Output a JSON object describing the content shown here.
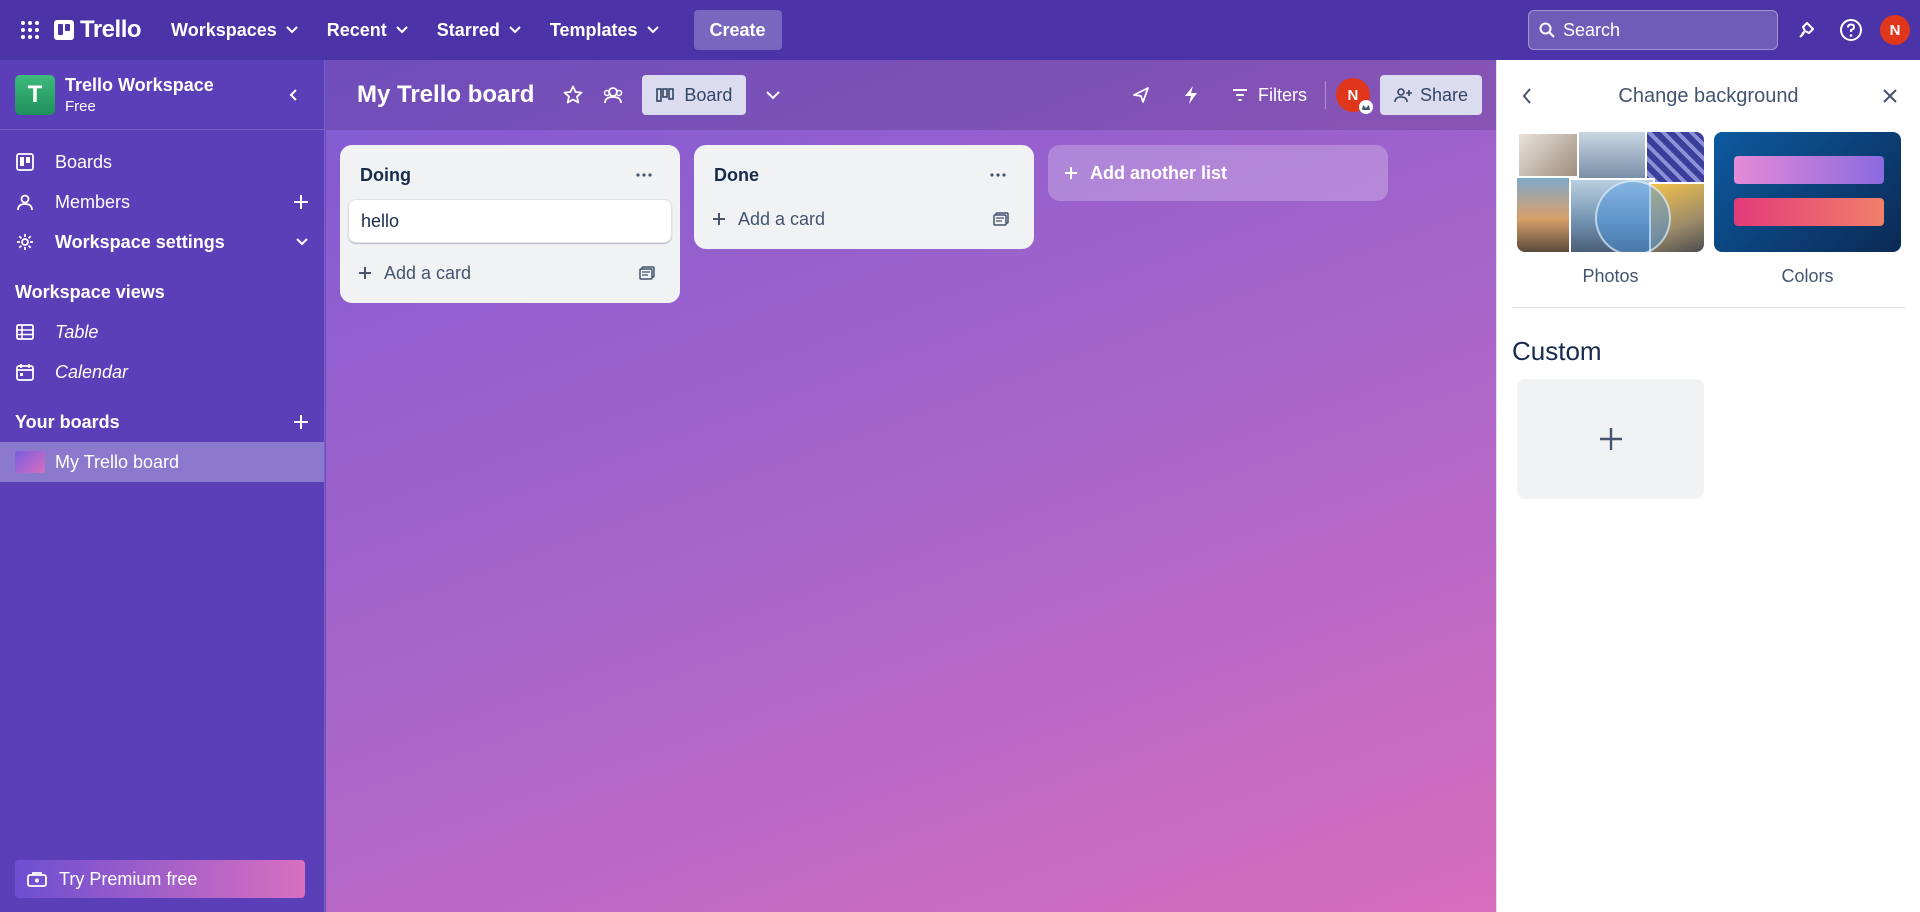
{
  "topnav": {
    "logo_text": "Trello",
    "menus": [
      {
        "label": "Workspaces"
      },
      {
        "label": "Recent"
      },
      {
        "label": "Starred"
      },
      {
        "label": "Templates"
      }
    ],
    "create_label": "Create",
    "search_placeholder": "Search",
    "user_initial": "N"
  },
  "sidebar": {
    "workspace_initial": "T",
    "workspace_name": "Trello Workspace",
    "workspace_plan": "Free",
    "items": [
      {
        "label": "Boards",
        "icon": "trello-board-icon"
      },
      {
        "label": "Members",
        "icon": "person-icon"
      },
      {
        "label": "Workspace settings",
        "icon": "gear-icon"
      }
    ],
    "views_title": "Workspace views",
    "views": [
      {
        "label": "Table",
        "icon": "table-icon"
      },
      {
        "label": "Calendar",
        "icon": "calendar-icon"
      }
    ],
    "your_boards_title": "Your boards",
    "boards": [
      {
        "label": "My Trello board"
      }
    ],
    "premium_label": "Try Premium free"
  },
  "board": {
    "title": "My Trello board",
    "view_label": "Board",
    "filters_label": "Filters",
    "member_initial": "N",
    "share_label": "Share",
    "lists": [
      {
        "title": "Doing",
        "cards": [
          "hello"
        ],
        "add_card_label": "Add a card"
      },
      {
        "title": "Done",
        "cards": [],
        "add_card_label": "Add a card"
      }
    ],
    "add_list_label": "Add another list"
  },
  "panel": {
    "title": "Change background",
    "options": [
      {
        "label": "Photos"
      },
      {
        "label": "Colors"
      }
    ],
    "custom_title": "Custom"
  },
  "colors": {
    "topnav": "#4a34a8",
    "sidebar": "#5a3fb8",
    "avatar": "#e0361b",
    "board_gradient_start": "#7f5ad2",
    "board_gradient_end": "#d86dbe"
  }
}
